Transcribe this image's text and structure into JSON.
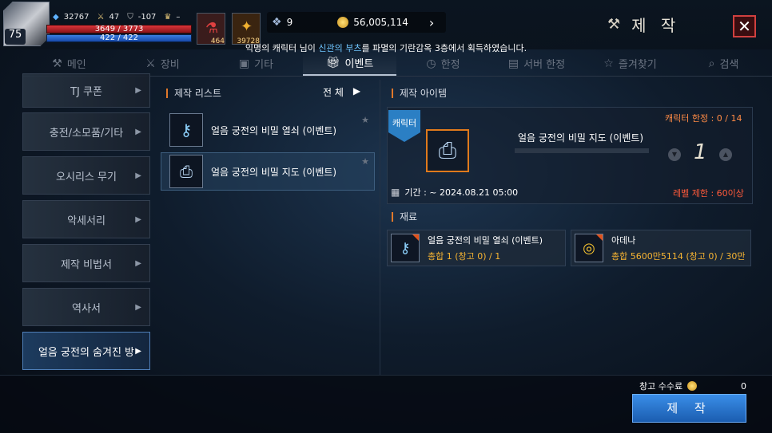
{
  "player": {
    "level": "75",
    "combat_power": "32767",
    "stat_attack": "47",
    "stat_defense": "-107",
    "trophy": "–",
    "hp": "3649 / 3773",
    "mp": "422 / 422",
    "slot1_count": "464",
    "slot2_count": "39728"
  },
  "currency": {
    "crystal": "9",
    "gold": "56,005,114"
  },
  "window_title": "제 작",
  "notice": {
    "prefix": "익명의 캐릭터 님이 ",
    "highlight": "신관의 부츠",
    "suffix": "를 파멸의 기란감옥 3층에서 획득하였습니다."
  },
  "tabs": [
    {
      "label": "메인",
      "icon": "anvil-icon"
    },
    {
      "label": "장비",
      "icon": "swords-icon"
    },
    {
      "label": "기타",
      "icon": "box-icon"
    },
    {
      "label": "이벤트",
      "icon": "gift-icon"
    },
    {
      "label": "한정",
      "icon": "clock-icon"
    },
    {
      "label": "서버 한정",
      "icon": "server-icon"
    },
    {
      "label": "즐겨찾기",
      "icon": "star-icon"
    },
    {
      "label": "검색",
      "icon": "search-icon"
    }
  ],
  "sidebar": [
    "TJ 쿠폰",
    "충전/소모품/기타",
    "오시리스 무기",
    "악세서리",
    "제작 비법서",
    "역사서",
    "얼음 궁전의 숨겨진 방"
  ],
  "list": {
    "header": "제작 리스트",
    "filter": "전 체",
    "items": [
      {
        "name": "얼음 궁전의 비밀 열쇠 (이벤트)",
        "icon": "key-icon"
      },
      {
        "name": "얼음 궁전의 비밀 지도 (이벤트)",
        "icon": "scroll-icon"
      }
    ]
  },
  "detail": {
    "header": "제작 아이템",
    "badge": "캐릭터",
    "item_name": "얼음 궁전의 비밀 지도 (이벤트)",
    "char_limit": "캐릭터 한정 : 0 / 14",
    "quantity": "1",
    "period": "기간 : ~ 2024.08.21 05:00",
    "level_limit": "레벨 제한 : 60이상"
  },
  "materials": {
    "header": "재료",
    "items": [
      {
        "name": "얼음 궁전의 비밀 열쇠 (이벤트)",
        "count": "총합 1 (창고 0) / 1",
        "icon": "key-icon"
      },
      {
        "name": "아데나",
        "count": "총합 5600만5114 (창고 0) / 30만",
        "icon": "gold-coins-icon"
      }
    ]
  },
  "footer": {
    "storage_fee_label": "창고 수수료",
    "storage_fee_value": "0",
    "craft_button": "제 작"
  }
}
